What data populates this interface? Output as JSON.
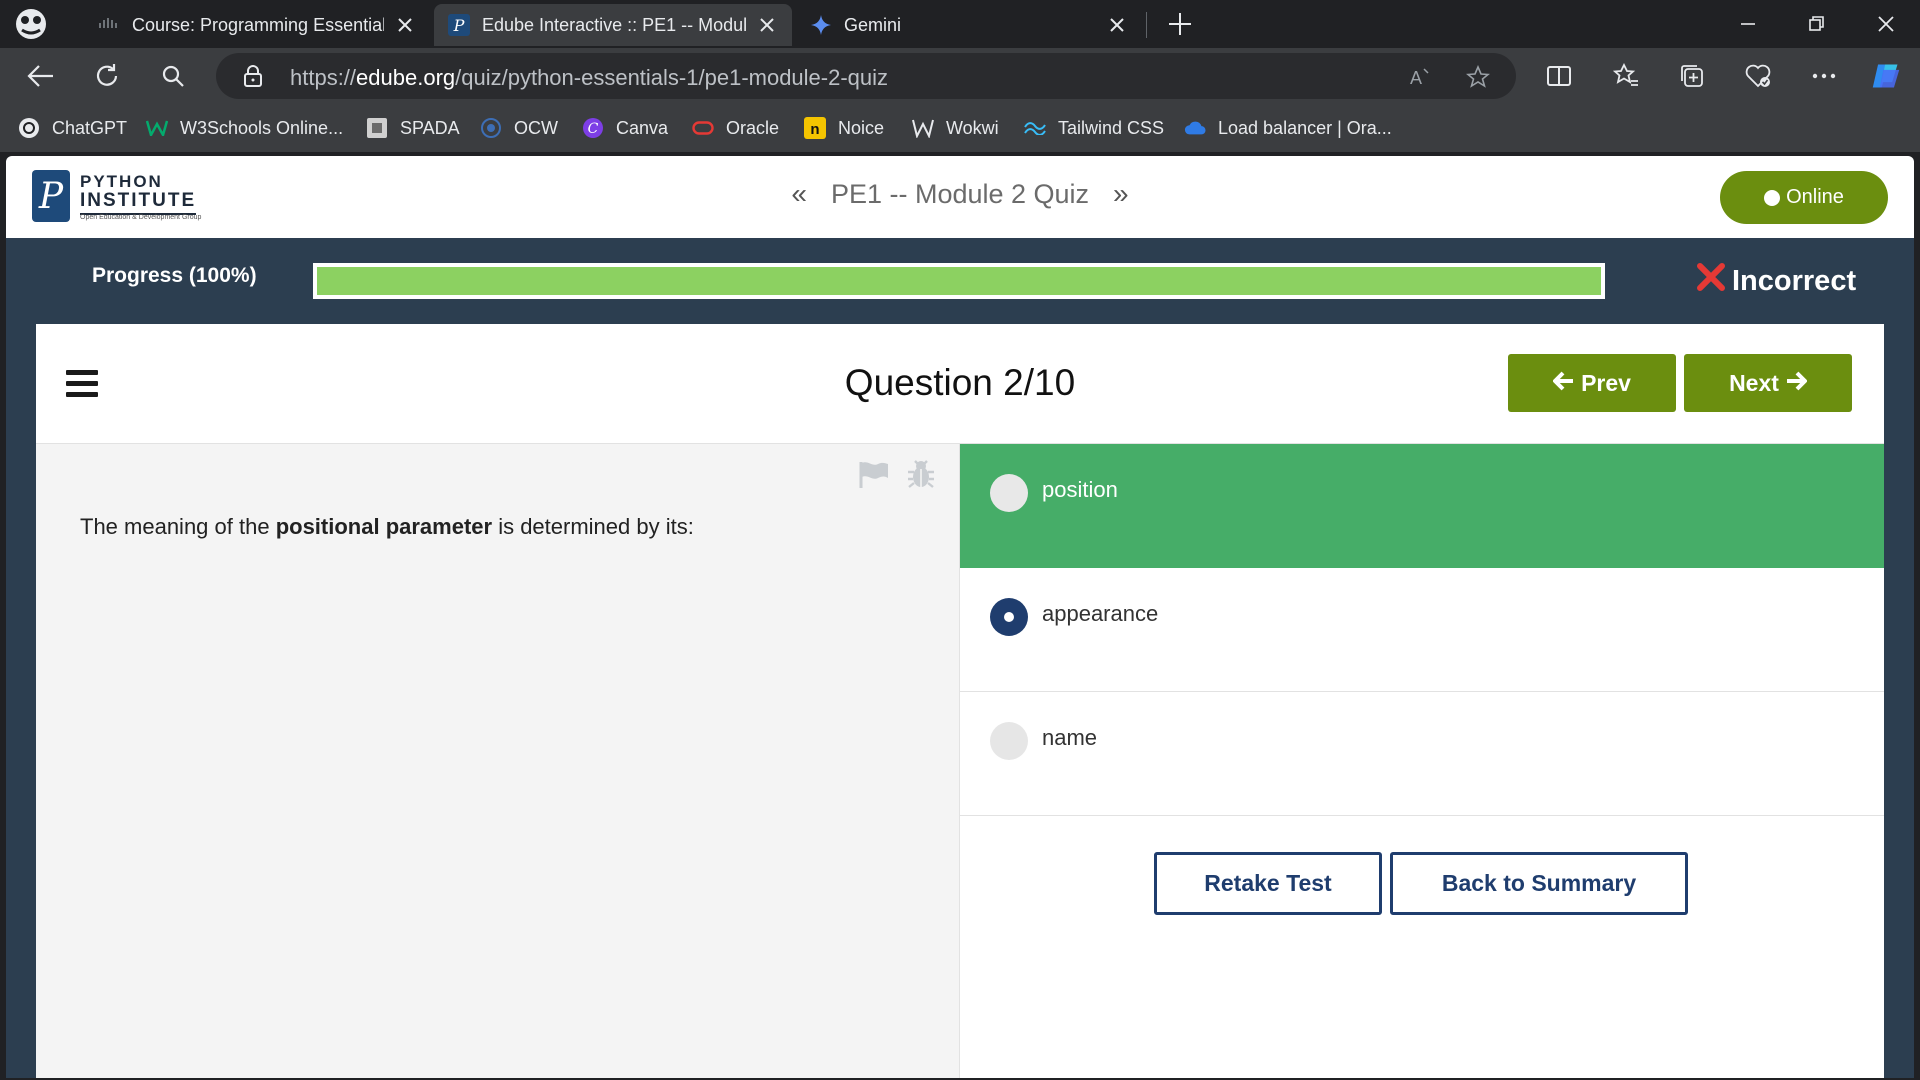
{
  "browser": {
    "tabs": [
      {
        "title": "Course: Programming Essentials",
        "icon": "cisco-icon",
        "active": false
      },
      {
        "title": "Edube Interactive :: PE1 -- Modul",
        "icon": "python-institute-icon",
        "active": true
      },
      {
        "title": "Gemini",
        "icon": "gemini-icon",
        "active": false
      }
    ],
    "address": {
      "scheme": "https://",
      "host": "edube.org",
      "path": "/quiz/python-essentials-1/pe1-module-2-quiz"
    },
    "bookmarks": [
      {
        "label": "ChatGPT",
        "icon": "chatgpt-icon"
      },
      {
        "label": "W3Schools Online...",
        "icon": "w3schools-icon"
      },
      {
        "label": "SPADA",
        "icon": "spada-icon"
      },
      {
        "label": "OCW",
        "icon": "ocw-icon"
      },
      {
        "label": "Canva",
        "icon": "canva-icon"
      },
      {
        "label": "Oracle",
        "icon": "oracle-icon"
      },
      {
        "label": "Noice",
        "icon": "noice-icon"
      },
      {
        "label": "Wokwi",
        "icon": "wokwi-icon"
      },
      {
        "label": "Tailwind CSS",
        "icon": "tailwind-icon"
      },
      {
        "label": "Load balancer | Ora...",
        "icon": "cloud-icon"
      }
    ]
  },
  "site": {
    "logo": {
      "line1": "PYTHON",
      "line2": "INSTITUTE",
      "line3": "Open Education & Development Group",
      "badge": "P"
    },
    "nav_title": "PE1 -- Module 2 Quiz",
    "status": "Online",
    "colors": {
      "brand_green": "#6b8e0f",
      "correct_green": "#46ad68",
      "navy": "#1f3d6e",
      "progress_green": "#8cd161",
      "incorrect_red": "#e53935"
    }
  },
  "progress": {
    "label": "Progress (100%)",
    "fraction": 1.0,
    "verdict": "Incorrect"
  },
  "question": {
    "title": "Question 2/10",
    "prev_label": "Prev",
    "next_label": "Next",
    "text_before": "The meaning of the ",
    "text_bold": "positional parameter",
    "text_after": " is determined by its:",
    "answers": [
      {
        "label": "position",
        "state": "correct",
        "selected": false
      },
      {
        "label": "appearance",
        "state": "normal",
        "selected": true
      },
      {
        "label": "name",
        "state": "normal",
        "selected": false
      }
    ],
    "retake_label": "Retake Test",
    "summary_label": "Back to Summary"
  }
}
